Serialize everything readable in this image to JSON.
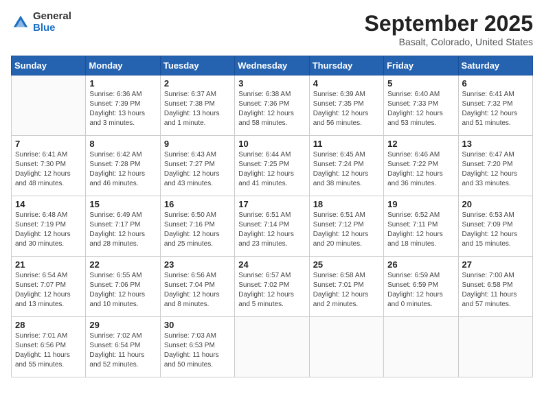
{
  "logo": {
    "general": "General",
    "blue": "Blue"
  },
  "title": "September 2025",
  "location": "Basalt, Colorado, United States",
  "days_header": [
    "Sunday",
    "Monday",
    "Tuesday",
    "Wednesday",
    "Thursday",
    "Friday",
    "Saturday"
  ],
  "weeks": [
    [
      {
        "day": "",
        "text": ""
      },
      {
        "day": "1",
        "text": "Sunrise: 6:36 AM\nSunset: 7:39 PM\nDaylight: 13 hours\nand 3 minutes."
      },
      {
        "day": "2",
        "text": "Sunrise: 6:37 AM\nSunset: 7:38 PM\nDaylight: 13 hours\nand 1 minute."
      },
      {
        "day": "3",
        "text": "Sunrise: 6:38 AM\nSunset: 7:36 PM\nDaylight: 12 hours\nand 58 minutes."
      },
      {
        "day": "4",
        "text": "Sunrise: 6:39 AM\nSunset: 7:35 PM\nDaylight: 12 hours\nand 56 minutes."
      },
      {
        "day": "5",
        "text": "Sunrise: 6:40 AM\nSunset: 7:33 PM\nDaylight: 12 hours\nand 53 minutes."
      },
      {
        "day": "6",
        "text": "Sunrise: 6:41 AM\nSunset: 7:32 PM\nDaylight: 12 hours\nand 51 minutes."
      }
    ],
    [
      {
        "day": "7",
        "text": "Sunrise: 6:41 AM\nSunset: 7:30 PM\nDaylight: 12 hours\nand 48 minutes."
      },
      {
        "day": "8",
        "text": "Sunrise: 6:42 AM\nSunset: 7:28 PM\nDaylight: 12 hours\nand 46 minutes."
      },
      {
        "day": "9",
        "text": "Sunrise: 6:43 AM\nSunset: 7:27 PM\nDaylight: 12 hours\nand 43 minutes."
      },
      {
        "day": "10",
        "text": "Sunrise: 6:44 AM\nSunset: 7:25 PM\nDaylight: 12 hours\nand 41 minutes."
      },
      {
        "day": "11",
        "text": "Sunrise: 6:45 AM\nSunset: 7:24 PM\nDaylight: 12 hours\nand 38 minutes."
      },
      {
        "day": "12",
        "text": "Sunrise: 6:46 AM\nSunset: 7:22 PM\nDaylight: 12 hours\nand 36 minutes."
      },
      {
        "day": "13",
        "text": "Sunrise: 6:47 AM\nSunset: 7:20 PM\nDaylight: 12 hours\nand 33 minutes."
      }
    ],
    [
      {
        "day": "14",
        "text": "Sunrise: 6:48 AM\nSunset: 7:19 PM\nDaylight: 12 hours\nand 30 minutes."
      },
      {
        "day": "15",
        "text": "Sunrise: 6:49 AM\nSunset: 7:17 PM\nDaylight: 12 hours\nand 28 minutes."
      },
      {
        "day": "16",
        "text": "Sunrise: 6:50 AM\nSunset: 7:16 PM\nDaylight: 12 hours\nand 25 minutes."
      },
      {
        "day": "17",
        "text": "Sunrise: 6:51 AM\nSunset: 7:14 PM\nDaylight: 12 hours\nand 23 minutes."
      },
      {
        "day": "18",
        "text": "Sunrise: 6:51 AM\nSunset: 7:12 PM\nDaylight: 12 hours\nand 20 minutes."
      },
      {
        "day": "19",
        "text": "Sunrise: 6:52 AM\nSunset: 7:11 PM\nDaylight: 12 hours\nand 18 minutes."
      },
      {
        "day": "20",
        "text": "Sunrise: 6:53 AM\nSunset: 7:09 PM\nDaylight: 12 hours\nand 15 minutes."
      }
    ],
    [
      {
        "day": "21",
        "text": "Sunrise: 6:54 AM\nSunset: 7:07 PM\nDaylight: 12 hours\nand 13 minutes."
      },
      {
        "day": "22",
        "text": "Sunrise: 6:55 AM\nSunset: 7:06 PM\nDaylight: 12 hours\nand 10 minutes."
      },
      {
        "day": "23",
        "text": "Sunrise: 6:56 AM\nSunset: 7:04 PM\nDaylight: 12 hours\nand 8 minutes."
      },
      {
        "day": "24",
        "text": "Sunrise: 6:57 AM\nSunset: 7:02 PM\nDaylight: 12 hours\nand 5 minutes."
      },
      {
        "day": "25",
        "text": "Sunrise: 6:58 AM\nSunset: 7:01 PM\nDaylight: 12 hours\nand 2 minutes."
      },
      {
        "day": "26",
        "text": "Sunrise: 6:59 AM\nSunset: 6:59 PM\nDaylight: 12 hours\nand 0 minutes."
      },
      {
        "day": "27",
        "text": "Sunrise: 7:00 AM\nSunset: 6:58 PM\nDaylight: 11 hours\nand 57 minutes."
      }
    ],
    [
      {
        "day": "28",
        "text": "Sunrise: 7:01 AM\nSunset: 6:56 PM\nDaylight: 11 hours\nand 55 minutes."
      },
      {
        "day": "29",
        "text": "Sunrise: 7:02 AM\nSunset: 6:54 PM\nDaylight: 11 hours\nand 52 minutes."
      },
      {
        "day": "30",
        "text": "Sunrise: 7:03 AM\nSunset: 6:53 PM\nDaylight: 11 hours\nand 50 minutes."
      },
      {
        "day": "",
        "text": ""
      },
      {
        "day": "",
        "text": ""
      },
      {
        "day": "",
        "text": ""
      },
      {
        "day": "",
        "text": ""
      }
    ]
  ]
}
